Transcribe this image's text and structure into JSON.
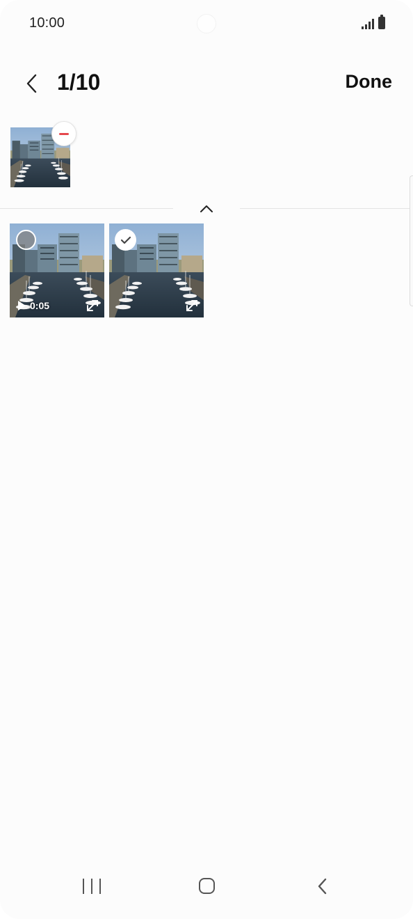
{
  "status_bar": {
    "time": "10:00",
    "icons": [
      "signal-icon",
      "battery-icon"
    ]
  },
  "header": {
    "back_icon": "chevron-left-icon",
    "counter": "1/10",
    "done_label": "Done"
  },
  "selected_tray": {
    "items": [
      {
        "thumbnail": "harbor-photo",
        "remove_icon": "minus-icon",
        "remove_color": "#e5484d"
      }
    ]
  },
  "collapse_icon": "chevron-up-icon",
  "gallery": {
    "items": [
      {
        "type": "video",
        "duration": "0:05",
        "selected": false,
        "expand_icon": "expand-icon"
      },
      {
        "type": "image",
        "selected": true,
        "expand_icon": "expand-icon"
      }
    ]
  },
  "nav_bar": {
    "icons": [
      "recents-icon",
      "home-icon",
      "back-icon"
    ]
  },
  "colors": {
    "background": "#fcfcfc",
    "accent_remove": "#e5484d",
    "text": "#111111"
  }
}
